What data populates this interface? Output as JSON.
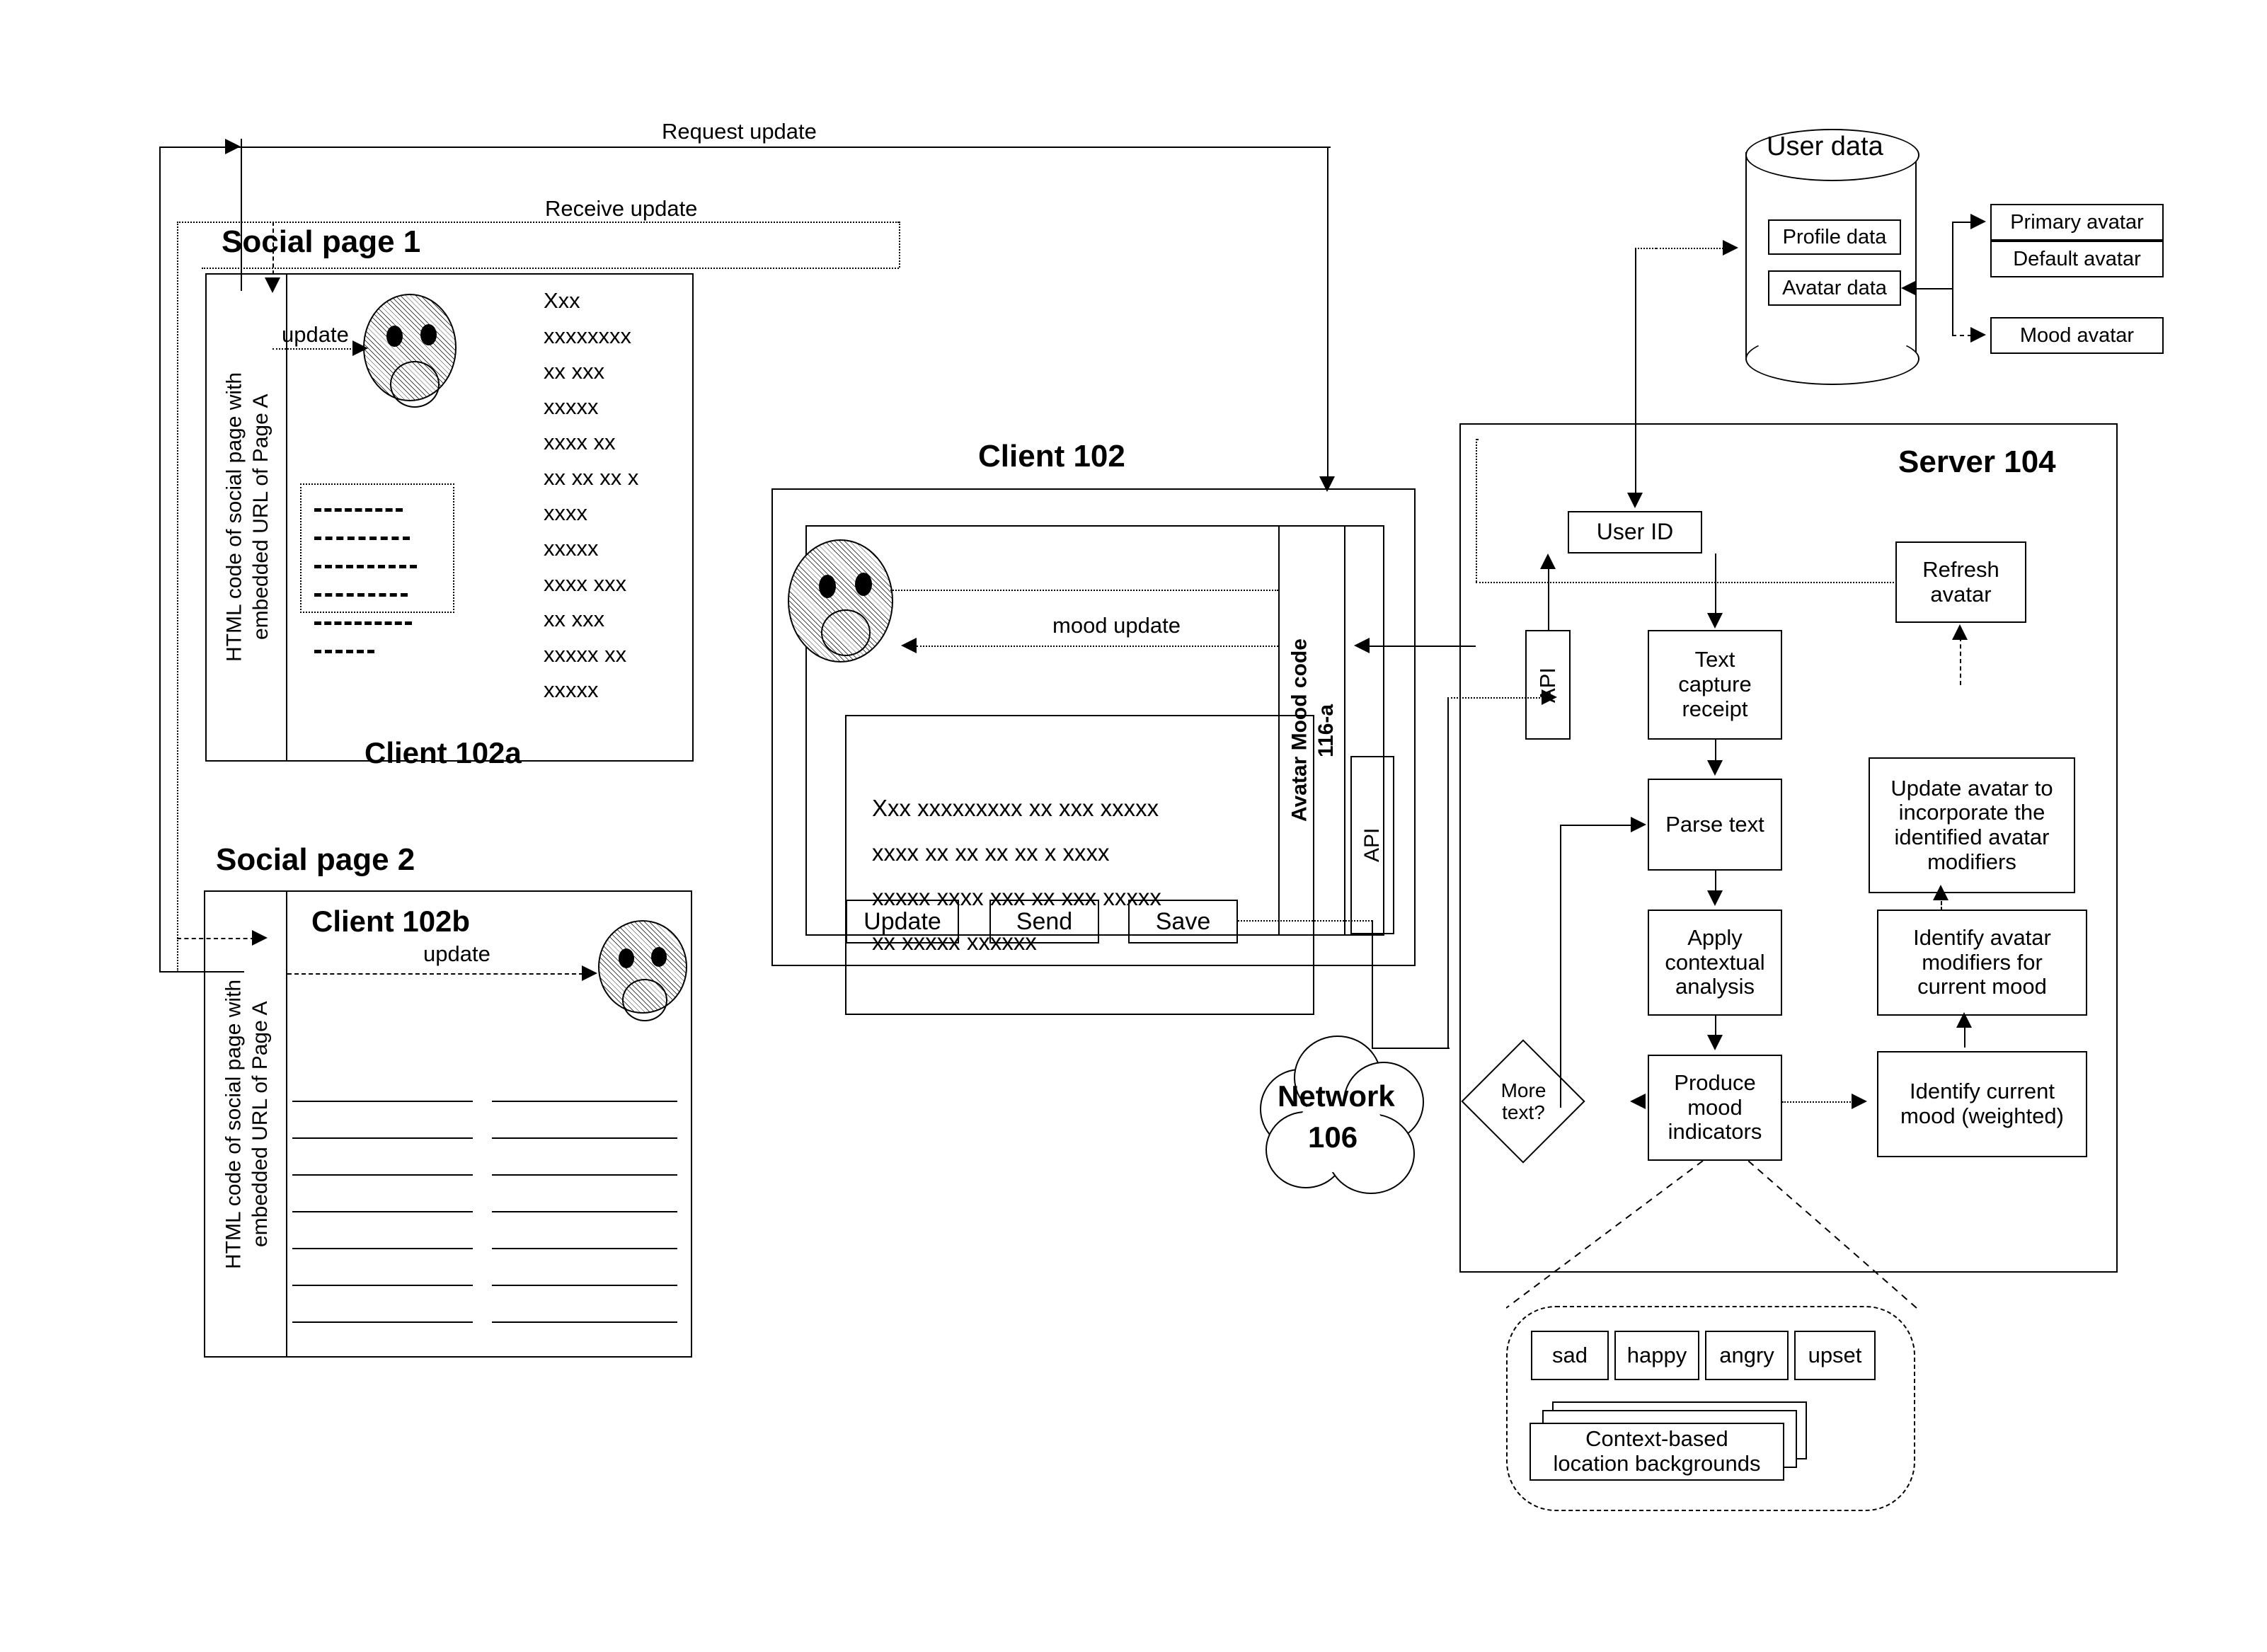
{
  "flow_labels": {
    "request_update": "Request update",
    "receive_update": "Receive update",
    "update": "update",
    "update2": "update",
    "mood_update": "mood update"
  },
  "social_page_1": {
    "title": "Social page 1",
    "html_code_label": "HTML code of social page with\nembedded URL of Page A",
    "client_label": "Client 102a",
    "post_lines": [
      "Xxx",
      "xxxxxxxx",
      "xx xxx",
      "xxxxx",
      "xxxx  xx",
      "xx xx xx x",
      "xxxx",
      "xxxxx",
      "xxxx xxx",
      "xx xxx",
      "xxxxx xx",
      "xxxxx"
    ]
  },
  "social_page_2": {
    "title": "Social page 2",
    "html_code_label": "HTML code of social page with\nembedded URL of Page A",
    "client_label": "Client 102b"
  },
  "client_102": {
    "title": "Client 102",
    "avatar_mood_code_label": "Avatar Mood code\n116-a",
    "api_label": "API",
    "message_lines": [
      "Xxx xxxxxxxxx xx xxx xxxxx",
      "xxxx  xx  xx xx xx x xxxx",
      "xxxxx xxxx xxx xx xxx xxxxx",
      "xx xxxxx xxxxxx"
    ],
    "buttons": [
      "Update",
      "Send",
      "Save"
    ]
  },
  "network": {
    "name": "Network",
    "number": "106"
  },
  "user_data": {
    "title": "User data",
    "profile_data": "Profile data",
    "avatar_data": "Avatar data",
    "primary_avatar": "Primary avatar",
    "default_avatar": "Default avatar",
    "mood_avatar": "Mood avatar"
  },
  "server": {
    "title": "Server 104",
    "user_id": "User ID",
    "api": "API",
    "text_capture_receipt": "Text\ncapture\nreceipt",
    "parse_text": "Parse text",
    "apply_contextual_analysis": "Apply\ncontextual\nanalysis",
    "more_text": "More\ntext?",
    "produce_mood_indicators": "Produce\nmood\nindicators",
    "identify_current_mood": "Identify current\nmood (weighted)",
    "identify_avatar_modifiers": "Identify avatar\nmodifiers for\ncurrent mood",
    "update_avatar": "Update avatar to\nincorporate the\nidentified avatar\nmodifiers",
    "refresh_avatar": "Refresh\navatar"
  },
  "mood_detail": {
    "moods": [
      "sad",
      "happy",
      "angry",
      "upset"
    ],
    "backgrounds_label": "Context-based\nlocation backgrounds"
  },
  "colors": {
    "ink": "#000000",
    "paper": "#ffffff"
  }
}
